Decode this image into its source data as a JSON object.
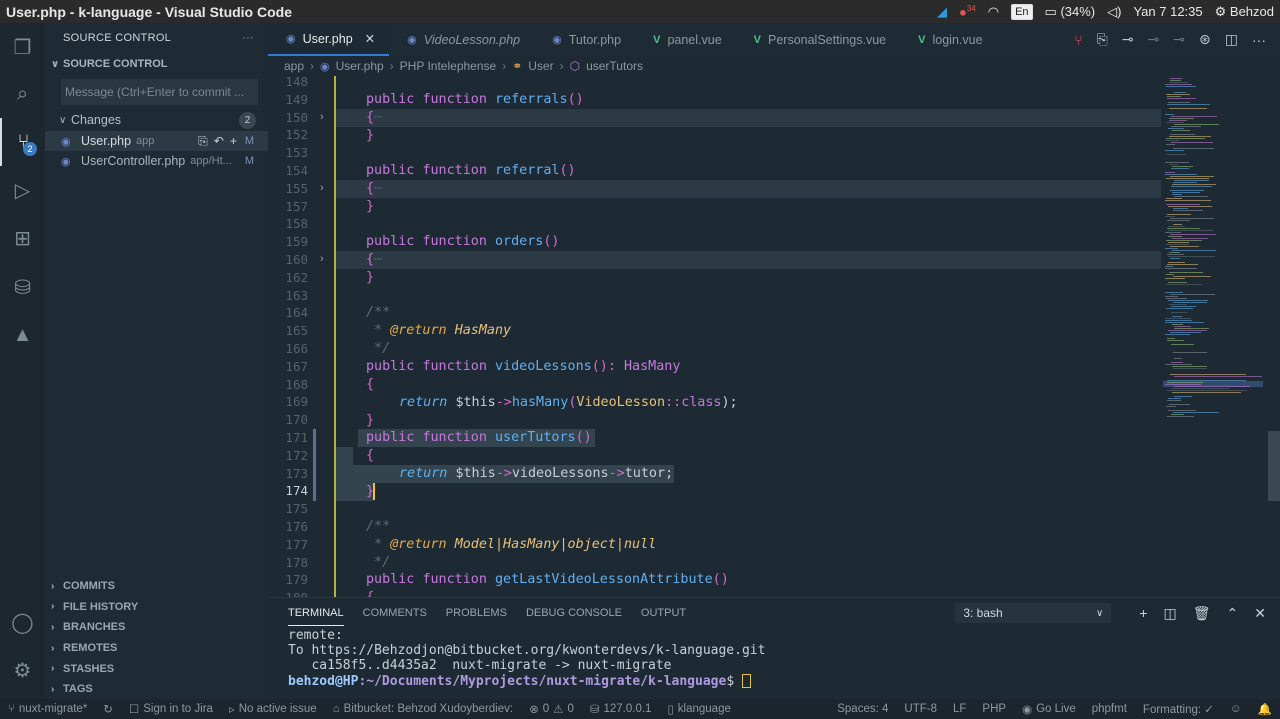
{
  "window": {
    "title": "User.php - k-language - Visual Studio Code",
    "tray": {
      "battery": "(34%)",
      "lang": "En",
      "datetime": "Yan  7 12:35",
      "user": "Behzod",
      "notif_count": "34"
    }
  },
  "activity_bar": {
    "scm_badge": "2"
  },
  "sidebar": {
    "header": "SOURCE CONTROL",
    "more": "···",
    "section": "SOURCE CONTROL",
    "commit_placeholder": "Message (Ctrl+Enter to commit ...",
    "changes_label": "Changes",
    "changes_count": "2",
    "files": [
      {
        "name": "User.php",
        "dir": "app",
        "status": "M"
      },
      {
        "name": "UserController.php",
        "dir": "app/Ht...",
        "status": "M"
      }
    ],
    "bottom_sections": [
      "COMMITS",
      "FILE HISTORY",
      "BRANCHES",
      "REMOTES",
      "STASHES",
      "TAGS"
    ]
  },
  "tabs": [
    {
      "label": "User.php",
      "type": "php",
      "active": true,
      "close": "✕"
    },
    {
      "label": "VideoLesson.php",
      "type": "php",
      "italic": true
    },
    {
      "label": "Tutor.php",
      "type": "php"
    },
    {
      "label": "panel.vue",
      "type": "vue"
    },
    {
      "label": "PersonalSettings.vue",
      "type": "vue"
    },
    {
      "label": "login.vue",
      "type": "vue"
    }
  ],
  "breadcrumbs": [
    "app",
    "User.php",
    "PHP Intelephense",
    "User",
    "userTutors"
  ],
  "editor": {
    "line_numbers": [
      "148",
      "149",
      "150",
      "152",
      "153",
      "154",
      "155",
      "157",
      "158",
      "159",
      "160",
      "162",
      "163",
      "164",
      "165",
      "166",
      "167",
      "168",
      "169",
      "170",
      "171",
      "172",
      "173",
      "174",
      "175",
      "176",
      "177",
      "178",
      "179",
      "180"
    ],
    "current_line": "174",
    "code": {
      "pub": "public",
      "func": "function",
      "referrals": "referrals",
      "referral": "referral",
      "orders": "orders",
      "paren": "()",
      "open_fold": "{",
      "ellipsis": "⋯",
      "close": "}",
      "doc_open": "/**",
      "doc_star": " * ",
      "doc_close": " */",
      "at_return": "@return",
      "hasmany_type": "HasMany",
      "videoLessons": "videoLessons",
      "colon_type": "(): ",
      "return": "return",
      "this": "$this",
      "arrow": "->",
      "hasMany": "hasMany",
      "VideoLesson": "VideoLesson",
      "dcolon": "::",
      "class": "class",
      "end": ");",
      "userTutors": "userTutors",
      "tutor": "tutor",
      "semi": ";",
      "ret2_types": "Model|HasMany|object|null",
      "getLast": "getLastVideoLessonAttribute",
      "open": "("
    }
  },
  "panel": {
    "tabs": [
      "TERMINAL",
      "COMMENTS",
      "PROBLEMS",
      "DEBUG CONSOLE",
      "OUTPUT"
    ],
    "terminal_select": "3: bash",
    "lines": [
      "remote:",
      "To https://Behzodjon@bitbucket.org/kwonterdevs/k-language.git",
      "   ca158f5..d4435a2  nuxt-migrate -> nuxt-migrate"
    ],
    "prompt_user": "behzod@HP",
    "prompt_path": ":~/Documents/Myprojects/nuxt-migrate/k-language",
    "prompt_end": "$ "
  },
  "status_bar": {
    "branch": "nuxt-migrate*",
    "jira": "Sign in to Jira",
    "issue": "No active issue",
    "bitbucket": "Bitbucket: Behzod Xudoyberdiev:",
    "errors": "0",
    "warnings": "0",
    "server": "127.0.0.1",
    "folder": "klanguage",
    "spaces": "Spaces: 4",
    "encoding": "UTF-8",
    "eol": "LF",
    "lang": "PHP",
    "golive": "Go Live",
    "phpfmt": "phpfmt",
    "formatting": "Formatting: ✓"
  }
}
